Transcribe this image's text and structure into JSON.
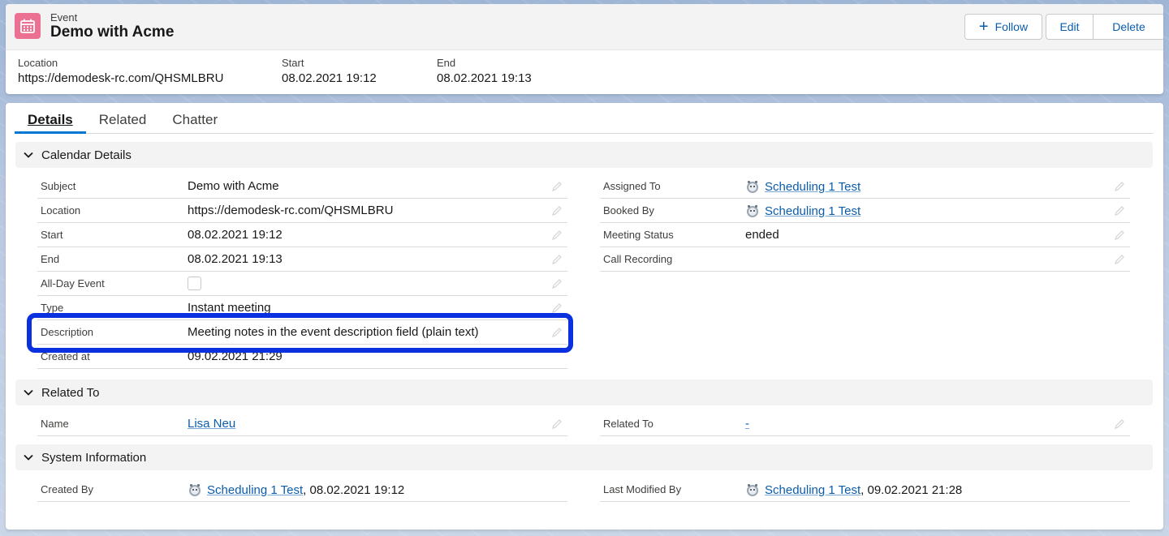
{
  "header": {
    "record_type": "Event",
    "title": "Demo with Acme",
    "follow_label": "Follow",
    "edit_label": "Edit",
    "delete_label": "Delete",
    "highlights": [
      {
        "label": "Location",
        "value": "https://demodesk-rc.com/QHSMLBRU"
      },
      {
        "label": "Start",
        "value": "08.02.2021 19:12"
      },
      {
        "label": "End",
        "value": "08.02.2021 19:13"
      }
    ]
  },
  "tabs": [
    "Details",
    "Related",
    "Chatter"
  ],
  "sections": {
    "calendar": {
      "title": "Calendar Details",
      "left": [
        {
          "label": "Subject",
          "value": "Demo with Acme"
        },
        {
          "label": "Location",
          "value": "https://demodesk-rc.com/QHSMLBRU"
        },
        {
          "label": "Start",
          "value": "08.02.2021 19:12"
        },
        {
          "label": "End",
          "value": "08.02.2021 19:13"
        },
        {
          "label": "All-Day Event",
          "value": ""
        },
        {
          "label": "Type",
          "value": "Instant meeting"
        },
        {
          "label": "Description",
          "value": "Meeting notes in the event description field (plain text)"
        },
        {
          "label": "Created at",
          "value": "09.02.2021 21:29"
        }
      ],
      "right": [
        {
          "label": "Assigned To",
          "value": "Scheduling 1 Test"
        },
        {
          "label": "Booked By",
          "value": "Scheduling 1 Test"
        },
        {
          "label": "Meeting Status",
          "value": "ended"
        },
        {
          "label": "Call Recording",
          "value": ""
        }
      ]
    },
    "related": {
      "title": "Related To",
      "name_label": "Name",
      "name_value": "Lisa Neu",
      "related_label": "Related To",
      "related_value": "-"
    },
    "system": {
      "title": "System Information",
      "created_label": "Created By",
      "created_user": "Scheduling 1 Test",
      "created_date": ", 08.02.2021 19:12",
      "modified_label": "Last Modified By",
      "modified_user": "Scheduling 1 Test",
      "modified_date": ", 09.02.2021 21:28"
    }
  },
  "colors": {
    "brand_link": "#0b5cab",
    "event_icon": "#eb7092",
    "highlight_border": "#0a30e0",
    "tab_active": "#0176d3"
  }
}
